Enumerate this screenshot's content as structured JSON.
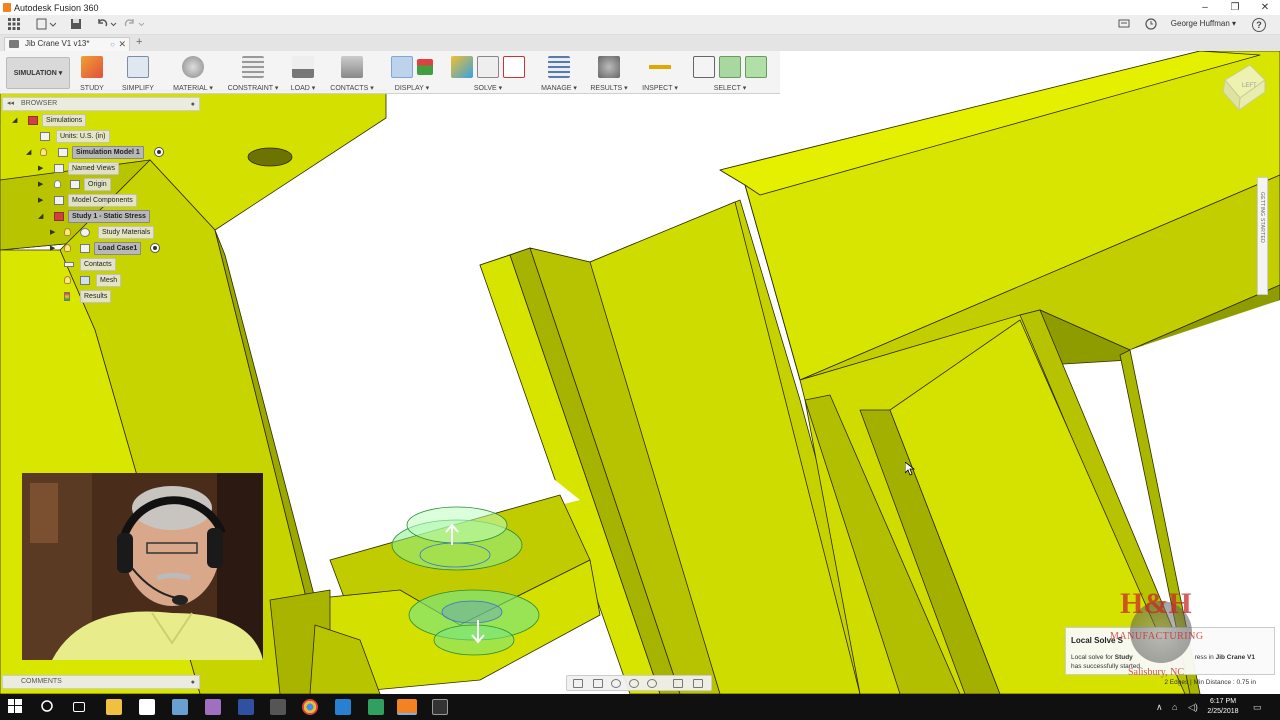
{
  "window": {
    "title": "Autodesk Fusion 360",
    "controls": [
      "–",
      "❐",
      "✕"
    ]
  },
  "quick_access": {
    "user": "George Huffman ▾",
    "help": "?"
  },
  "document_tab": {
    "name": "Jib Crane V1 v13*",
    "close": "✕",
    "new_tab": "+"
  },
  "ribbon": {
    "workspace": "SIMULATION ▾",
    "groups": [
      {
        "label": "STUDY"
      },
      {
        "label": "SIMPLIFY"
      },
      {
        "label": "MATERIAL ▾"
      },
      {
        "label": "CONSTRAINT ▾"
      },
      {
        "label": "LOAD ▾"
      },
      {
        "label": "CONTACTS ▾"
      },
      {
        "label": "DISPLAY ▾"
      },
      {
        "label": "SOLVE ▾"
      },
      {
        "label": "MANAGE ▾"
      },
      {
        "label": "RESULTS ▾"
      },
      {
        "label": "INSPECT ▾"
      },
      {
        "label": "SELECT ▾"
      }
    ]
  },
  "browser": {
    "title": "BROWSER",
    "nodes": {
      "simulations": "Simulations",
      "units": "Units: U.S. (in)",
      "sim_model": "Simulation Model 1",
      "named_views": "Named Views",
      "origin": "Origin",
      "model_components": "Model Components",
      "study": "Study 1 - Static Stress",
      "study_materials": "Study Materials",
      "load_case": "Load Case1",
      "contacts": "Contacts",
      "mesh": "Mesh",
      "results": "Results"
    }
  },
  "comments": {
    "title": "COMMENTS"
  },
  "side_panel": {
    "label": "GETTING STARTED"
  },
  "viewcube": {
    "face": "LEFT"
  },
  "notification": {
    "title": "Local Solve S",
    "message_prefix": "Local solve for",
    "study_bold": "Study",
    "message_mid": "ress in",
    "model_bold": "Jib Crane V1",
    "message_suffix": "has successfully started."
  },
  "status": {
    "selection": "2 Edges | Min Distance : 0.75 in"
  },
  "watermark": {
    "line1": "H&H",
    "line2": "MANUFACTURING",
    "line3": "Salisbury, NC"
  },
  "taskbar": {
    "time": "6:17 PM",
    "date": "2/25/2018"
  },
  "colors": {
    "model_yellow": "#d4e000",
    "model_shadow": "#9aa800",
    "edge": "#2a2a00"
  }
}
